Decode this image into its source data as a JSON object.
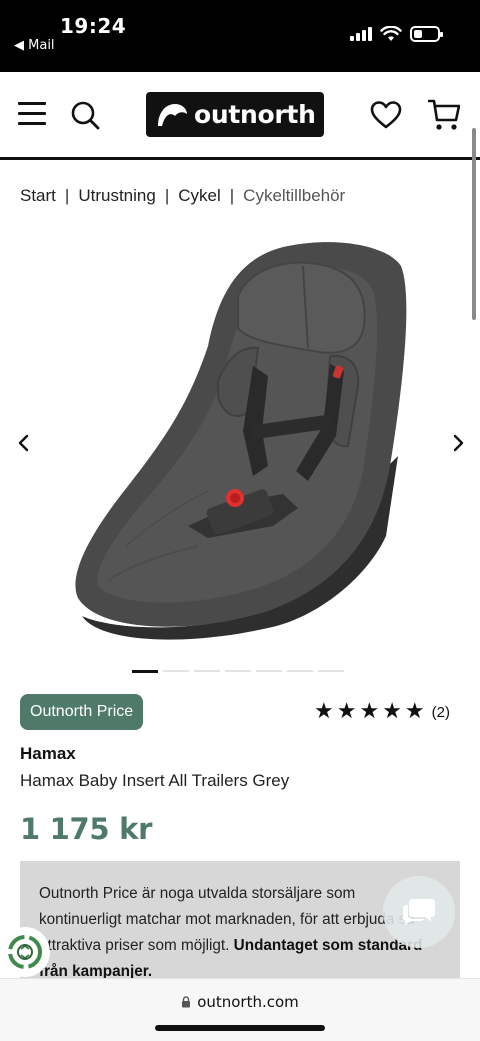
{
  "status_bar": {
    "time": "19:24",
    "back_app": "◀ Mail",
    "battery_level": 0.35
  },
  "header": {
    "logo_text": "outnorth",
    "icons": [
      "menu-icon",
      "search-icon",
      "heart-icon",
      "cart-icon"
    ]
  },
  "breadcrumb": {
    "items": [
      "Start",
      "Utrustning",
      "Cykel",
      "Cykeltillbehör"
    ],
    "separator": "|"
  },
  "gallery": {
    "image_count": 7,
    "active_index": 0
  },
  "product": {
    "badge": "Outnorth Price",
    "rating_stars": 5,
    "rating_count": "(2)",
    "brand": "Hamax",
    "name": "Hamax Baby Insert All Trailers Grey",
    "price": "1 175 kr"
  },
  "info_box": {
    "text": "Outnorth Price är noga utvalda storsäljare som kontinuerligt matchar mot marknaden, för att erbjuda så attraktiva priser som möjligt.",
    "bold_text": "Undantaget som standard från kampanjer."
  },
  "bottom_bar": {
    "url": "outnorth.com"
  },
  "colors": {
    "accent_green": "#4f7a6a",
    "info_box_bg": "#d7d7d7",
    "header_dark": "#111111"
  }
}
